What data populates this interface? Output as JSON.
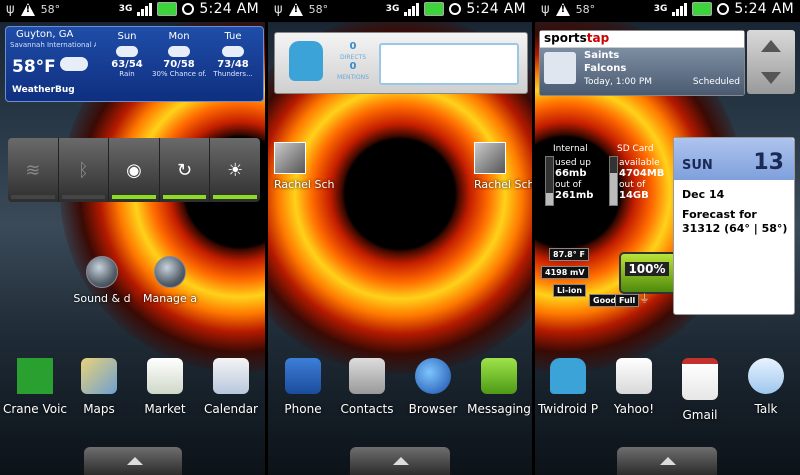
{
  "status": {
    "temp": "58°",
    "network": "3G",
    "time": "5:24 AM"
  },
  "weather": {
    "location": "Guyton, GA",
    "station": "Savannah International Ai...",
    "temp": "58°F",
    "brand": "WeatherBug",
    "days": [
      {
        "name": "Sun",
        "hilo": "63/54",
        "cond": "Rain"
      },
      {
        "name": "Mon",
        "hilo": "70/58",
        "cond": "30% Chance of..."
      },
      {
        "name": "Tue",
        "hilo": "73/48",
        "cond": "Thunders..."
      }
    ]
  },
  "power_control": [
    "wifi",
    "bluetooth",
    "gps",
    "sync",
    "brightness"
  ],
  "shortcuts1": [
    {
      "label": "Sound & d"
    },
    {
      "label": "Manage a"
    }
  ],
  "twidroid": {
    "directs_count": "0",
    "directs_label": "DIRECTS",
    "mentions_count": "0",
    "mentions_label": "MENTIONS"
  },
  "contacts": [
    {
      "name": "Rachel Sch"
    },
    {
      "name": "Rachel Sch"
    }
  ],
  "sportstap": {
    "brand_a": "sports",
    "brand_b": "tap",
    "team1": "Saints",
    "team2": "Falcons",
    "date": "Today, 1:00 PM",
    "status": "Scheduled"
  },
  "memory": {
    "internal_title": "Internal",
    "internal_used_label": "used up",
    "internal_used": "66mb",
    "internal_of_label": "out of",
    "internal_total": "261mb",
    "internal_fill": 0.25,
    "sd_title": "SD Card",
    "sd_avail_label": "available",
    "sd_avail": "4704MB",
    "sd_of_label": "out of",
    "sd_total": "14GB",
    "sd_fill": 0.66
  },
  "battery": {
    "temp": "87.8° F",
    "voltage": "4198 mV",
    "chem": "Li-ion",
    "percent": "100%",
    "health": "Good",
    "state": "Full"
  },
  "calendar": {
    "dow": "SUN",
    "day": "13",
    "date": "Dec 14",
    "forecast_line1": "Forecast for",
    "forecast_line2": "31312 (64° | 58°)"
  },
  "dock1": [
    "Crane Voic",
    "Maps",
    "Market",
    "Calendar"
  ],
  "dock2": [
    "Phone",
    "Contacts",
    "Browser",
    "Messaging"
  ],
  "dock3": [
    "Twidroid P",
    "Yahoo!",
    "Gmail",
    "Talk"
  ]
}
